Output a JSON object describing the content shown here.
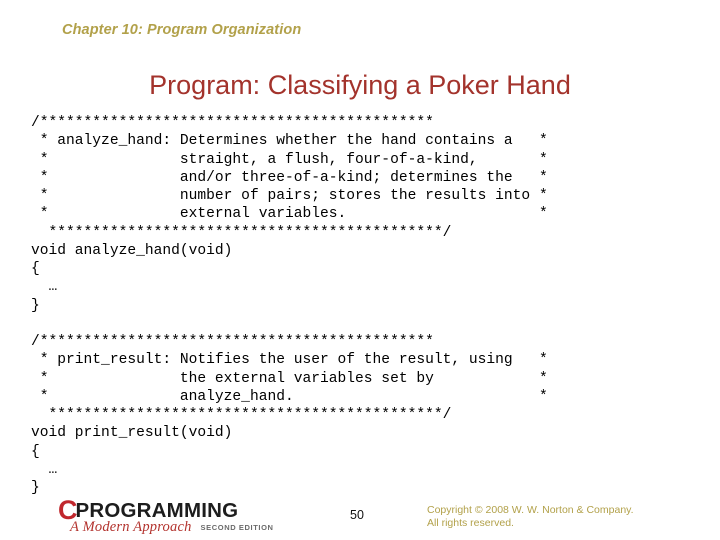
{
  "header": {
    "chapter": "Chapter 10: Program Organization",
    "title": "Program: Classifying a Poker Hand",
    "chapter_color": "#b2a14a",
    "title_color": "#a3332c"
  },
  "code": {
    "block1": "/*********************************************\n * analyze_hand: Determines whether the hand contains a   *\n *               straight, a flush, four-of-a-kind,       *\n *               and/or three-of-a-kind; determines the   *\n *               number of pairs; stores the results into *\n *               external variables.                      *\n  *********************************************/\nvoid analyze_hand(void)\n{\n  …\n}",
    "block2": "/*********************************************\n * print_result: Notifies the user of the result, using   *\n *               the external variables set by            *\n *               analyze_hand.                            *\n  *********************************************/\nvoid print_result(void)\n{\n  …\n}"
  },
  "footer": {
    "logo": {
      "c_letter": "C",
      "word": "PROGRAMMING",
      "tagline": "A Modern Approach",
      "edition": "SECOND EDITION",
      "c_color": "#c0272d",
      "word_color": "#1d1d1d",
      "tagline_color": "#b3332e"
    },
    "page_number": "50",
    "copyright": "Copyright © 2008 W. W. Norton & Company.\nAll rights reserved.",
    "copyright_color": "#b2a14a"
  }
}
